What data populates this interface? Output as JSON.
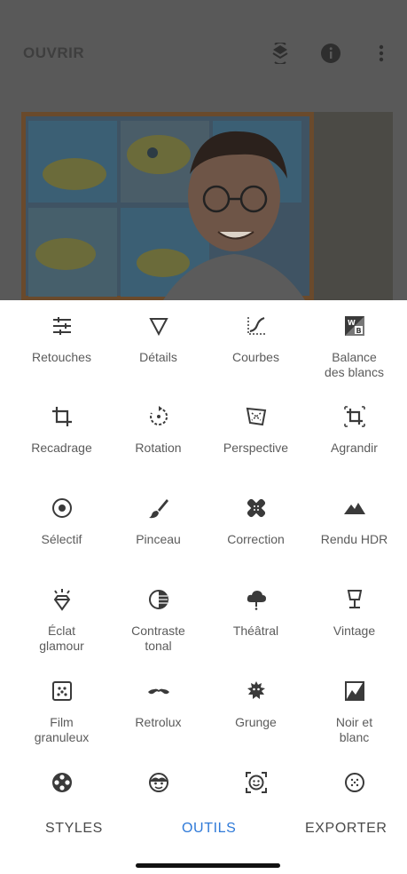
{
  "header": {
    "open_label": "OUVRIR",
    "icons": [
      "layers-undo-icon",
      "info-icon",
      "more-vertical-icon"
    ]
  },
  "tools": [
    {
      "label": "Retouches",
      "icon": "sliders-icon"
    },
    {
      "label": "Détails",
      "icon": "triangle-down-icon"
    },
    {
      "label": "Courbes",
      "icon": "curves-icon"
    },
    {
      "label": "Balance\ndes blancs",
      "icon": "white-balance-icon"
    },
    {
      "label": "Recadrage",
      "icon": "crop-icon"
    },
    {
      "label": "Rotation",
      "icon": "rotate-icon"
    },
    {
      "label": "Perspective",
      "icon": "perspective-icon"
    },
    {
      "label": "Agrandir",
      "icon": "expand-icon"
    },
    {
      "label": "Sélectif",
      "icon": "target-icon"
    },
    {
      "label": "Pinceau",
      "icon": "brush-icon"
    },
    {
      "label": "Correction",
      "icon": "bandage-icon"
    },
    {
      "label": "Rendu HDR",
      "icon": "mountains-icon"
    },
    {
      "label": "Éclat\nglamour",
      "icon": "diamond-glow-icon"
    },
    {
      "label": "Contraste\ntonal",
      "icon": "tonal-contrast-icon"
    },
    {
      "label": "Théâtral",
      "icon": "cloud-drama-icon"
    },
    {
      "label": "Vintage",
      "icon": "lamp-icon"
    },
    {
      "label": "Film\ngranuleux",
      "icon": "film-grain-icon"
    },
    {
      "label": "Retrolux",
      "icon": "mustache-icon"
    },
    {
      "label": "Grunge",
      "icon": "grunge-icon"
    },
    {
      "label": "Noir et\nblanc",
      "icon": "black-white-icon"
    },
    {
      "label": "",
      "icon": "film-reel-icon"
    },
    {
      "label": "",
      "icon": "face-icon"
    },
    {
      "label": "",
      "icon": "face-detect-icon"
    },
    {
      "label": "",
      "icon": "dotted-circle-icon"
    }
  ],
  "nav": {
    "styles": "STYLES",
    "tools": "OUTILS",
    "export": "EXPORTER"
  },
  "colors": {
    "accent": "#2f7ad8",
    "dim": "#595959",
    "icon": "#3a3a3a",
    "text": "#5b5b5b"
  }
}
